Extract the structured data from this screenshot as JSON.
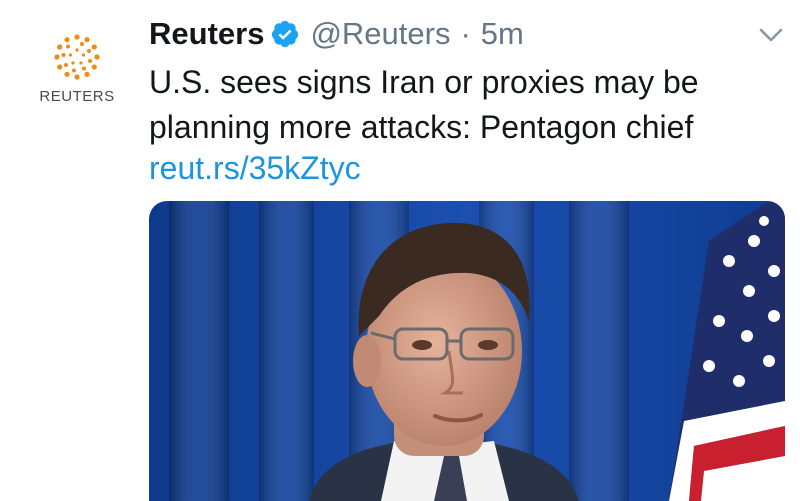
{
  "tweet": {
    "author_name": "Reuters",
    "handle": "@Reuters",
    "separator": "·",
    "time": "5m",
    "avatar_label": "REUTERS",
    "text": "U.S. sees signs Iran or proxies may be planning more attacks: Pentagon chief",
    "link": "reut.rs/35kZtyc",
    "verified_icon": "verified-badge-icon",
    "menu_icon": "chevron-down-icon",
    "link_color": "#1b95e0"
  }
}
